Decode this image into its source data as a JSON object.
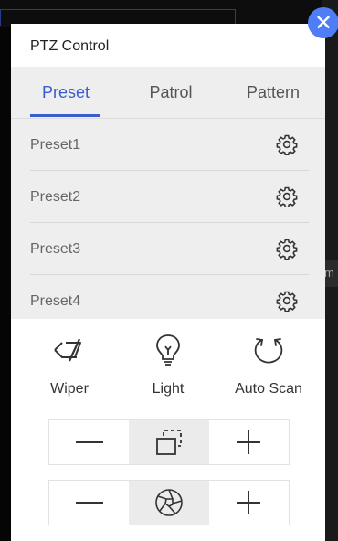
{
  "background": {
    "partial_text": "m"
  },
  "panel": {
    "title": "PTZ Control"
  },
  "close": {
    "glyph": "✕"
  },
  "tabs": [
    {
      "label": "Preset",
      "active": true
    },
    {
      "label": "Patrol",
      "active": false
    },
    {
      "label": "Pattern",
      "active": false
    }
  ],
  "presets": [
    {
      "label": "Preset1"
    },
    {
      "label": "Preset2"
    },
    {
      "label": "Preset3"
    },
    {
      "label": "Preset4"
    }
  ],
  "controls": {
    "wiper": {
      "label": "Wiper",
      "icon": "wiper-icon"
    },
    "light": {
      "label": "Light",
      "icon": "light-bulb-icon"
    },
    "auto_scan": {
      "label": "Auto Scan",
      "icon": "auto-scan-icon"
    }
  },
  "zoom": {
    "minus": "—",
    "plus": "+",
    "icon": "zoom-frame-icon"
  },
  "focus": {
    "minus": "—",
    "plus": "+",
    "icon": "aperture-icon"
  },
  "colors": {
    "accent": "#3b5ccc",
    "close_bg": "#4f7df5",
    "gray": "#eeeeee"
  }
}
